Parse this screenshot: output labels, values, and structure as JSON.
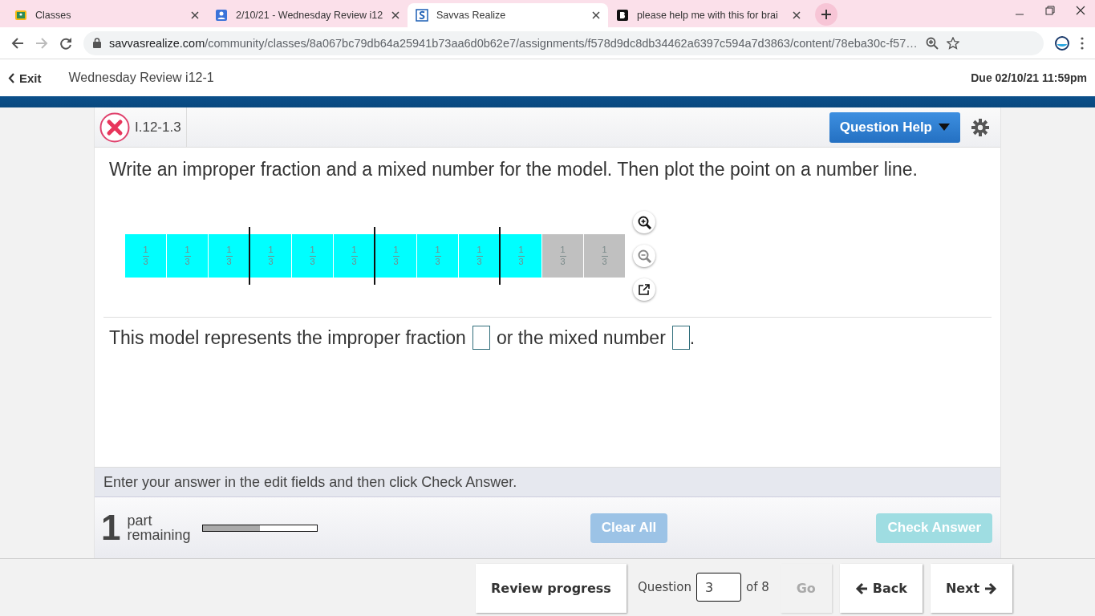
{
  "browser_tabs": [
    {
      "title": "Classes",
      "selected": false,
      "kind": "classroom"
    },
    {
      "title": "2/10/21 - Wednesday Review i12",
      "selected": false,
      "kind": "person"
    },
    {
      "title": "Savvas Realize",
      "selected": true,
      "kind": "savvas"
    },
    {
      "title": "please help me with this for brai",
      "selected": false,
      "kind": "brainly"
    }
  ],
  "address_bar": {
    "domain": "savvasrealize.com",
    "path": "/community/classes/8a067bc79db64a25941b73aa6d0b62e7/assignments/f578d9dc8db34462a6397c594a7d3863/content/78eba30c-f57…"
  },
  "app_header": {
    "exit": "Exit",
    "title": "Wednesday Review i12-1",
    "due": "Due 02/10/21 11:59pm"
  },
  "question": {
    "incorrect": true,
    "id": "I.12-1.3",
    "help_button": "Question Help",
    "prompt": "Write an improper fraction and a mixed number for the model. Then plot the point on a number line.",
    "model_cells": [
      {
        "numerator": "1",
        "denominator": "3",
        "shaded": true,
        "whole_end": false
      },
      {
        "numerator": "1",
        "denominator": "3",
        "shaded": true,
        "whole_end": false
      },
      {
        "numerator": "1",
        "denominator": "3",
        "shaded": true,
        "whole_end": true
      },
      {
        "numerator": "1",
        "denominator": "3",
        "shaded": true,
        "whole_end": false
      },
      {
        "numerator": "1",
        "denominator": "3",
        "shaded": true,
        "whole_end": false
      },
      {
        "numerator": "1",
        "denominator": "3",
        "shaded": true,
        "whole_end": true
      },
      {
        "numerator": "1",
        "denominator": "3",
        "shaded": true,
        "whole_end": false
      },
      {
        "numerator": "1",
        "denominator": "3",
        "shaded": true,
        "whole_end": false
      },
      {
        "numerator": "1",
        "denominator": "3",
        "shaded": true,
        "whole_end": true
      },
      {
        "numerator": "1",
        "denominator": "3",
        "shaded": true,
        "whole_end": false
      },
      {
        "numerator": "1",
        "denominator": "3",
        "shaded": false,
        "whole_end": false
      },
      {
        "numerator": "1",
        "denominator": "3",
        "shaded": false,
        "whole_end": false
      }
    ],
    "answer_parts": [
      {
        "kind": "text",
        "text": "This model represents the improper fraction"
      },
      {
        "kind": "field"
      },
      {
        "kind": "text",
        "text": "or the mixed number"
      },
      {
        "kind": "field"
      },
      {
        "kind": "text",
        "text": "."
      }
    ],
    "instruction": "Enter your answer in the edit fields and then click Check Answer.",
    "parts_count": "1",
    "parts_label_1": "part",
    "parts_label_2": "remaining",
    "progress": {
      "level": 0.5
    },
    "clear_button": {
      "label": "Clear All",
      "disabled": true
    },
    "check_button": {
      "label": "Check Answer",
      "disabled": true
    }
  },
  "footer": {
    "review": "Review progress",
    "question_label": "Question",
    "question_number": "3",
    "of_total": "of 8",
    "go": {
      "label": "Go",
      "disabled": true
    },
    "back": "Back",
    "next": "Next"
  }
}
